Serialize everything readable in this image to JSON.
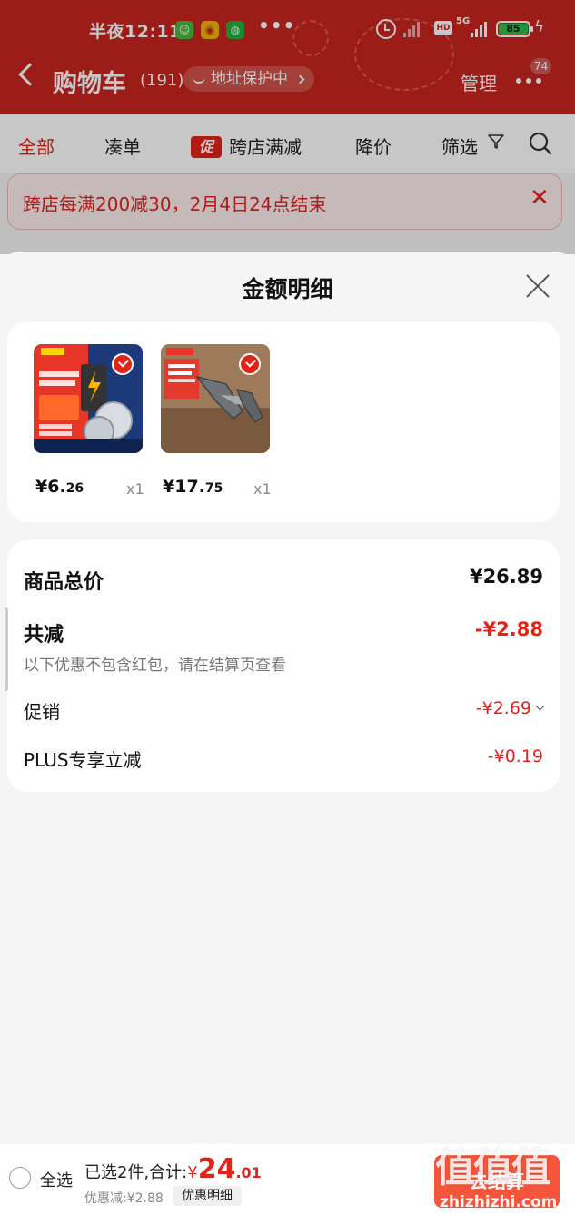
{
  "colors": {
    "brand_red": "#c8261e",
    "accent_red": "#e2231a",
    "checkout": "#f4553b",
    "battery": "#27c04a"
  },
  "status_bar": {
    "time": "半夜12:11",
    "overflow": "•••",
    "net_label": "5G",
    "hd": "HD",
    "battery": "85",
    "icons": [
      "app-green-icon",
      "weibo-icon",
      "wechat-icon",
      "alarm-icon",
      "signal-icon",
      "hd-icon",
      "signal-5g-icon",
      "battery-icon",
      "charging-icon"
    ]
  },
  "nav": {
    "title": "购物车",
    "count": "(191)",
    "address_protect": "地址保护中",
    "manage": "管理",
    "more_badge": "74"
  },
  "filters": [
    {
      "label": "全部",
      "active": true
    },
    {
      "label": "凑单"
    },
    {
      "label": "跨店满减",
      "tag": "促"
    },
    {
      "label": "降价"
    },
    {
      "label": "筛选"
    }
  ],
  "promo_banner": {
    "text": "跨店每满200减30，2月4日24点结束"
  },
  "sheet": {
    "title": "金额明细",
    "products": [
      {
        "price_int": "¥6.",
        "price_dec": "26",
        "qty": "x1",
        "image": "coin-battery-product"
      },
      {
        "price_int": "¥17.",
        "price_dec": "75",
        "qty": "x1",
        "image": "folding-knife-product"
      }
    ],
    "summary": {
      "total_label": "商品总价",
      "total_value": "¥26.89",
      "reduce_label": "共减",
      "reduce_value": "-¥2.88",
      "reduce_note": "以下优惠不包含红包，请在结算页查看",
      "promo_label": "促销",
      "promo_value": "-¥2.69",
      "plus_label": "PLUS专享立减",
      "plus_value": "-¥0.19"
    }
  },
  "bottom": {
    "select_all": "全选",
    "selected_text": "已选2件,合计:",
    "yen": "¥",
    "total_int": "24",
    "total_dec": ".01",
    "discount_text": "优惠减:¥2.88",
    "detail_button": "优惠明细",
    "checkout": "去结算",
    "watermark": "值值值",
    "watermark_url": "zhizhizhi.com"
  }
}
